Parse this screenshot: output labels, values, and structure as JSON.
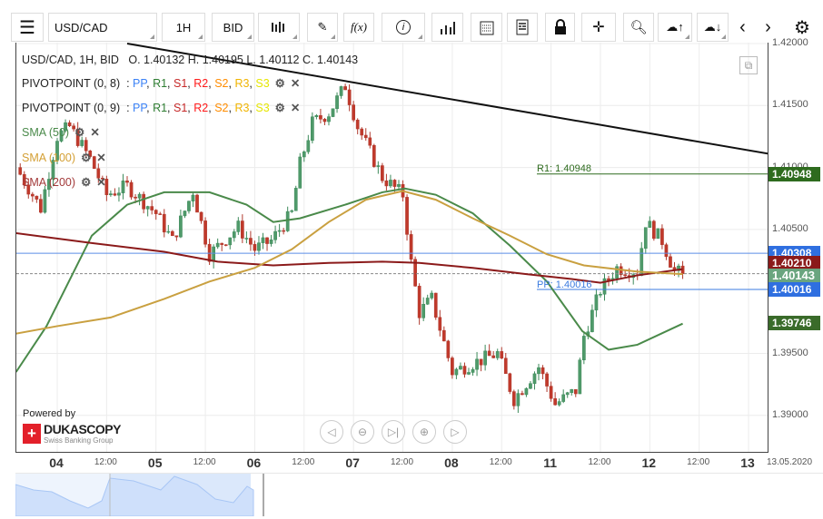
{
  "toolbar": {
    "symbol": "USD/CAD",
    "period": "1H",
    "side": "BID",
    "fx": "f(x)"
  },
  "legend": {
    "title": "USD/CAD, 1H, BID",
    "ohlc": "O. 1.40132 H. 1.40195 L. 1.40112 C. 1.40143",
    "pivots": [
      {
        "label": "PIVOTPOINT (0, 8)"
      },
      {
        "label": "PIVOTPOINT (0, 9)"
      }
    ],
    "pivot_lines": [
      {
        "text": "PP",
        "color": "#3b82f6"
      },
      {
        "text": "R1",
        "color": "#2e7d32"
      },
      {
        "text": "S1",
        "color": "#c62828"
      },
      {
        "text": "R2",
        "color": "#ff1a1a"
      },
      {
        "text": "S2",
        "color": "#ff8c00"
      },
      {
        "text": "R3",
        "color": "#f0b400"
      },
      {
        "text": "S3",
        "color": "#e6e600"
      }
    ],
    "smas": [
      {
        "label": "SMA (50)",
        "color": "#4a8a4a"
      },
      {
        "label": "SMA (100)",
        "color": "#d4a035"
      },
      {
        "label": "SMA (200)",
        "color": "#a33a3a"
      }
    ]
  },
  "chart_data": {
    "type": "candlestick",
    "symbol": "USD/CAD",
    "timeframe": "1H",
    "ylim": [
      1.3878,
      1.42
    ],
    "y_ticks": [
      "1.42000",
      "1.41500",
      "1.41000",
      "1.40500",
      "1.39500",
      "1.39000"
    ],
    "y_tick_values": [
      1.42,
      1.415,
      1.41,
      1.405,
      1.395,
      1.39
    ],
    "x_ticks": [
      {
        "label": "04",
        "h": 0,
        "day": true
      },
      {
        "label": "12:00",
        "h": 12
      },
      {
        "label": "05",
        "h": 24,
        "day": true
      },
      {
        "label": "12:00",
        "h": 36
      },
      {
        "label": "06",
        "h": 48,
        "day": true
      },
      {
        "label": "12:00",
        "h": 60
      },
      {
        "label": "07",
        "h": 72,
        "day": true
      },
      {
        "label": "12:00",
        "h": 84
      },
      {
        "label": "08",
        "h": 96,
        "day": true
      },
      {
        "label": "12:00",
        "h": 108
      },
      {
        "label": "11",
        "h": 120,
        "day": true
      },
      {
        "label": "12:00",
        "h": 132
      },
      {
        "label": "12",
        "h": 144,
        "day": true
      },
      {
        "label": "12:00",
        "h": 156
      },
      {
        "label": "13",
        "h": 168,
        "day": true
      }
    ],
    "date_label": "13.05.2020",
    "price_path": [
      [
        -10,
        1.41
      ],
      [
        -4,
        1.4067
      ],
      [
        0,
        1.4125
      ],
      [
        3,
        1.4133
      ],
      [
        8,
        1.4107
      ],
      [
        12,
        1.4078
      ],
      [
        17,
        1.4085
      ],
      [
        24,
        1.4063
      ],
      [
        28,
        1.4041
      ],
      [
        33,
        1.4081
      ],
      [
        37,
        1.403
      ],
      [
        44,
        1.4052
      ],
      [
        48,
        1.4034
      ],
      [
        52,
        1.4041
      ],
      [
        57,
        1.4063
      ],
      [
        59,
        1.4103
      ],
      [
        62,
        1.4136
      ],
      [
        66,
        1.4144
      ],
      [
        70,
        1.4166
      ],
      [
        73,
        1.4133
      ],
      [
        79,
        1.4092
      ],
      [
        84,
        1.4078
      ],
      [
        86,
        1.4023
      ],
      [
        88,
        1.3983
      ],
      [
        91,
        1.3994
      ],
      [
        96,
        1.3935
      ],
      [
        101,
        1.3942
      ],
      [
        107,
        1.395
      ],
      [
        111,
        1.3913
      ],
      [
        117,
        1.3939
      ],
      [
        121,
        1.3909
      ],
      [
        126,
        1.392
      ],
      [
        128,
        1.3964
      ],
      [
        132,
        1.4001
      ],
      [
        136,
        1.4019
      ],
      [
        141,
        1.4016
      ],
      [
        143,
        1.4056
      ],
      [
        147,
        1.4041
      ],
      [
        150,
        1.4016
      ],
      [
        152,
        1.40143
      ]
    ],
    "sma50": [
      [
        -10,
        1.3935
      ],
      [
        -2.6,
        1.3972
      ],
      [
        8.4,
        1.4045
      ],
      [
        17,
        1.407
      ],
      [
        26,
        1.408
      ],
      [
        37,
        1.408
      ],
      [
        46,
        1.407
      ],
      [
        52.5,
        1.4056
      ],
      [
        59,
        1.4059
      ],
      [
        70,
        1.407
      ],
      [
        79,
        1.408
      ],
      [
        84.5,
        1.4083
      ],
      [
        92,
        1.4078
      ],
      [
        101,
        1.4063
      ],
      [
        110,
        1.4037
      ],
      [
        119,
        1.4008
      ],
      [
        127.6,
        1.3968
      ],
      [
        134,
        1.3953
      ],
      [
        141,
        1.3957
      ],
      [
        152,
        1.3974
      ]
    ],
    "sma100": [
      [
        -10,
        1.3966
      ],
      [
        0,
        1.3972
      ],
      [
        13,
        1.3979
      ],
      [
        26,
        1.3994
      ],
      [
        37,
        1.4008
      ],
      [
        48,
        1.4019
      ],
      [
        57,
        1.4034
      ],
      [
        66,
        1.4056
      ],
      [
        75,
        1.4074
      ],
      [
        84,
        1.4081
      ],
      [
        92,
        1.4074
      ],
      [
        101,
        1.4059
      ],
      [
        110,
        1.4045
      ],
      [
        119,
        1.403
      ],
      [
        128,
        1.4021
      ],
      [
        141,
        1.4016
      ],
      [
        152,
        1.4014
      ]
    ],
    "sma200": [
      [
        -10,
        1.4047
      ],
      [
        8.4,
        1.4039
      ],
      [
        26,
        1.4032
      ],
      [
        39,
        1.4024
      ],
      [
        52.5,
        1.4021
      ],
      [
        66,
        1.4023
      ],
      [
        79,
        1.4024
      ],
      [
        88,
        1.4023
      ],
      [
        101,
        1.4019
      ],
      [
        114,
        1.4014
      ],
      [
        125,
        1.401
      ],
      [
        132,
        1.4007
      ],
      [
        141,
        1.4013
      ],
      [
        152,
        1.4018
      ]
    ],
    "trendline": [
      [
        17,
        1.42
      ],
      [
        173,
        1.4111
      ]
    ],
    "pivot_levels": {
      "r1": {
        "label": "R1: 1.40948",
        "value": 1.40948
      },
      "pp": {
        "label": "PP: 1.40016",
        "value": 1.40016
      },
      "aux": {
        "value": 1.40308
      }
    },
    "price_labels": [
      {
        "text": "1.40948",
        "value": 1.40948,
        "color": "#2e6b1e"
      },
      {
        "text": "1.40308",
        "value": 1.40308,
        "color": "#2f6fe0"
      },
      {
        "text": "1.40210",
        "value": 1.4021,
        "color": "#8b1a1a"
      },
      {
        "text": "1.40143",
        "value": 1.40143,
        "color": "#6aa57f"
      },
      {
        "text": "1.40016",
        "value": 1.40016,
        "color": "#2f6fe0"
      },
      {
        "text": "1.39746",
        "value": 1.39746,
        "color": "#3a6b2a"
      }
    ]
  },
  "branding": {
    "powered": "Powered by",
    "name": "DUKASCOPY",
    "sub": "Swiss Banking Group"
  }
}
